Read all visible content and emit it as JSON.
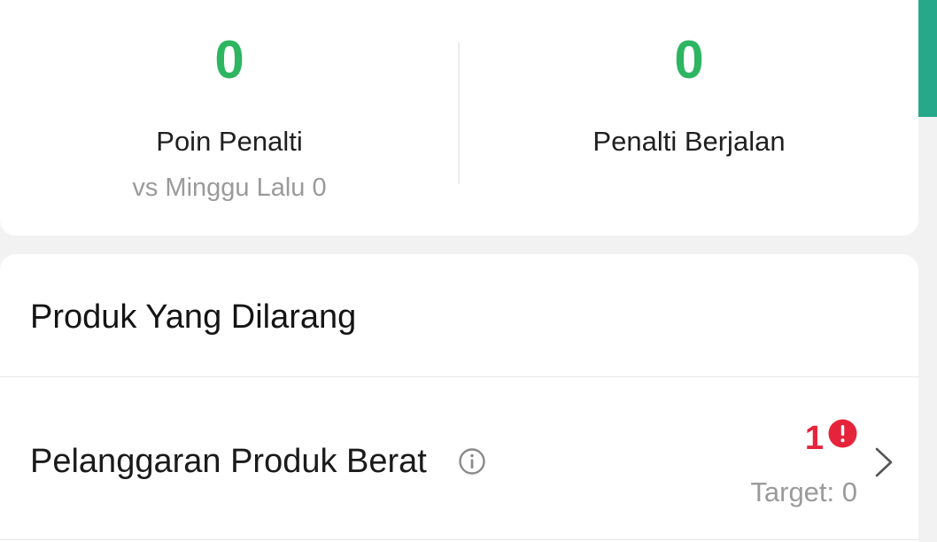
{
  "stats": {
    "penalty_points": {
      "value": "0",
      "label": "Poin Penalti",
      "comparison": "vs Minggu Lalu 0"
    },
    "ongoing_penalty": {
      "value": "0",
      "label": "Penalti Berjalan"
    }
  },
  "section": {
    "title": "Produk Yang Dilarang",
    "rows": [
      {
        "label": "Pelanggaran Produk Berat",
        "count": "1",
        "target": "Target: 0"
      }
    ]
  },
  "colors": {
    "positive": "#2db562",
    "alert": "#e5243b",
    "accent": "#27a88a"
  },
  "icons": {
    "info": "info-icon",
    "alert": "alert-icon",
    "chevron": "chevron-right-icon"
  }
}
